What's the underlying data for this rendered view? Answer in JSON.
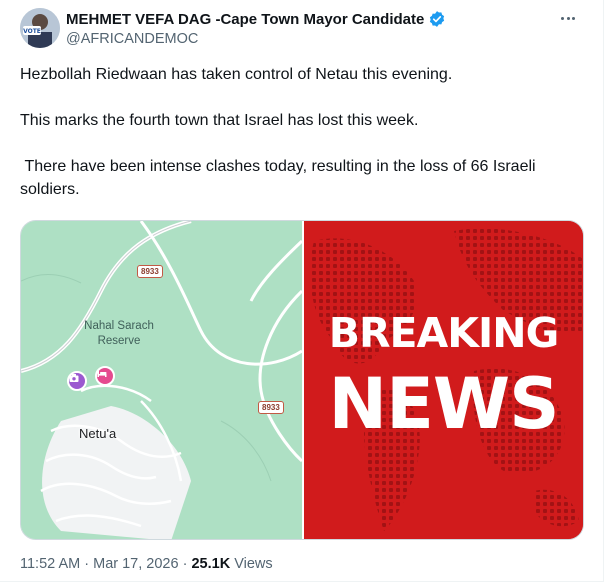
{
  "author": {
    "display_name": "MEHMET VEFA DAG -Cape Town Mayor Candidate",
    "handle": "@AFRICANDEMOC",
    "avatar_badge_text": "VOTE",
    "verified_color": "#1d9bf0"
  },
  "tweet": {
    "paragraphs": [
      "Hezbollah Riedwaan has taken control of Netau this evening.",
      "This marks the fourth town that Israel has lost this week.",
      " There have been intense clashes today, resulting in the loss of 66 Israeli soldiers."
    ]
  },
  "media": {
    "map": {
      "reserve_label_line1": "Nahal Sarach",
      "reserve_label_line2": "Reserve",
      "town_label": "Netu'a",
      "route_number_top": "8933",
      "route_number_right": "8933"
    },
    "image": {
      "headline_line1": "BREAKING",
      "headline_line2": "NEWS",
      "background_color": "#d11b1c"
    }
  },
  "meta": {
    "time": "11:52 AM",
    "separator": "·",
    "date": "Mar 17, 2026",
    "views_count": "25.1K",
    "views_label": "Views"
  },
  "icons": [
    "verified-badge-icon",
    "more-icon",
    "camera-pin-icon",
    "hotel-pin-icon"
  ],
  "colors": {
    "text_primary": "#0f1419",
    "text_secondary": "#536471",
    "map_green": "#aee0c4"
  }
}
